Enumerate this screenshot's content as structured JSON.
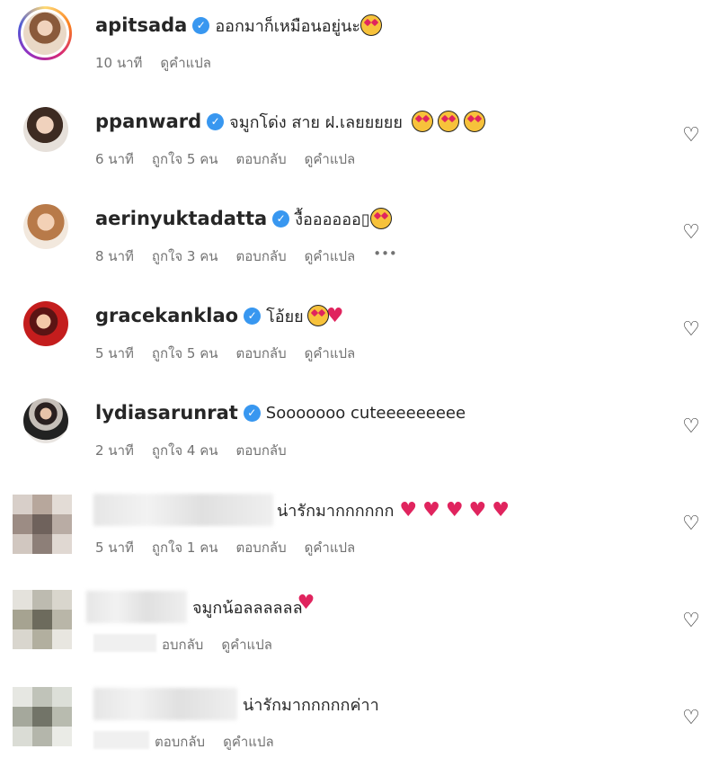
{
  "comments": [
    {
      "username": "apitsada",
      "verified": true,
      "text": "ออกมาก็เหมือนอยู่นะ",
      "emojis": "😍",
      "time": "10 นาที",
      "likes": "",
      "reply": "",
      "translate": "ดูคำแปล",
      "has_like_button": false
    },
    {
      "username": "ppanward",
      "verified": true,
      "text": "จมูกโด่ง สาย ฝ.เลยยยยย",
      "emojis": "😍😍😍",
      "time": "6 นาที",
      "likes": "ถูกใจ 5 คน",
      "reply": "ตอบกลับ",
      "translate": "ดูคำแปล",
      "has_like_button": true
    },
    {
      "username": "aerinyuktadatta",
      "verified": true,
      "text": "งื้ออออออ▯",
      "emojis": "😍",
      "time": "8 นาที",
      "likes": "ถูกใจ 3 คน",
      "reply": "ตอบกลับ",
      "translate": "ดูคำแปล",
      "more": "•••",
      "has_like_button": true
    },
    {
      "username": "gracekanklao",
      "verified": true,
      "text": "โอ้ยย",
      "emojis": "😍❤",
      "time": "5 นาที",
      "likes": "ถูกใจ 5 คน",
      "reply": "ตอบกลับ",
      "translate": "ดูคำแปล",
      "has_like_button": true
    },
    {
      "username": "lydiasarunrat",
      "verified": true,
      "text": "Sooooooo cuteeeeeeeee",
      "emojis": "",
      "time": "2 นาที",
      "likes": "ถูกใจ 4 คน",
      "reply": "ตอบกลับ",
      "translate": "",
      "has_like_button": true
    },
    {
      "username": "",
      "verified": false,
      "text": "น่ารักมากกกกกก",
      "emojis": "❤❤❤❤❤",
      "time": "5 นาที",
      "likes": "ถูกใจ 1 คน",
      "reply": "ตอบกลับ",
      "translate": "ดูคำแปล",
      "has_like_button": true
    },
    {
      "username": "",
      "verified": false,
      "text": "จมูกน้อลลลลลล",
      "emojis": "❤",
      "time": "",
      "likes": "",
      "reply": "อบกลับ",
      "translate": "ดูคำแปล",
      "has_like_button": true
    },
    {
      "username": "",
      "verified": false,
      "text": "น่ารักมากกกกกค่าา",
      "emojis": "",
      "time": "",
      "likes": "",
      "reply": "ตอบกลับ",
      "translate": "ดูคำแปล",
      "has_like_button": true
    }
  ],
  "icons": {
    "verified": "verified-badge-icon",
    "like": "heart-outline-icon"
  },
  "colors": {
    "verified": "#3897f0",
    "heart": "#e0245e",
    "meta_text": "#737373"
  }
}
